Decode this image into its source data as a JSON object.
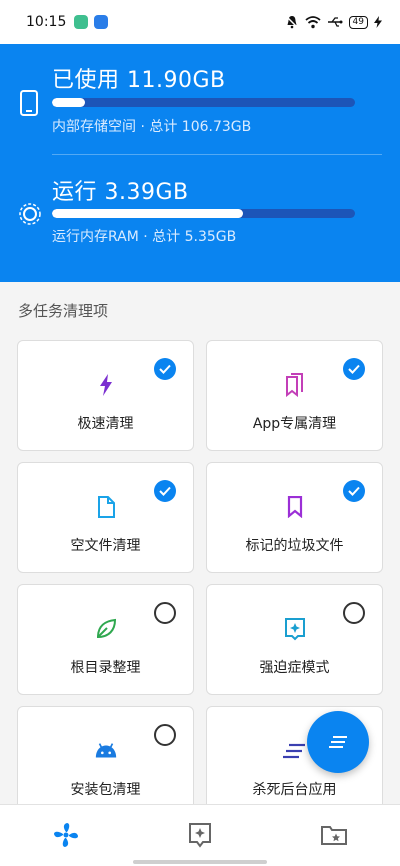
{
  "status_bar": {
    "time": "10:15",
    "battery": "49"
  },
  "storage": {
    "title": "已使用 11.90GB",
    "subtitle": "内部存储空间 · 总计 106.73GB",
    "used_fraction": 0.11
  },
  "ram": {
    "title": "运行 3.39GB",
    "subtitle": "运行内存RAM · 总计 5.35GB",
    "used_fraction": 0.63
  },
  "section_title": "多任务清理项",
  "cards": [
    {
      "label": "极速清理",
      "icon": "bolt-icon",
      "checked": true,
      "color": "#7b2fd0"
    },
    {
      "label": "App专属清理",
      "icon": "bookmarks-icon",
      "checked": true,
      "color": "#c33fb8"
    },
    {
      "label": "空文件清理",
      "icon": "file-icon",
      "checked": true,
      "color": "#1aa3e8"
    },
    {
      "label": "标记的垃圾文件",
      "icon": "bookmark-icon",
      "checked": true,
      "color": "#9b2fd6"
    },
    {
      "label": "根目录整理",
      "icon": "leaf-icon",
      "checked": false,
      "color": "#2fa84f"
    },
    {
      "label": "强迫症模式",
      "icon": "sparkle-box-icon",
      "checked": false,
      "color": "#1a9fd0"
    },
    {
      "label": "安装包清理",
      "icon": "android-icon",
      "checked": false,
      "color": "#1a7be0"
    },
    {
      "label": "杀死后台应用",
      "icon": "lines-icon",
      "checked": false,
      "color": "#3a3fb0"
    }
  ],
  "colors": {
    "accent": "#0a84f0"
  },
  "bottom_nav": [
    "fan-icon",
    "sparkle-box-icon",
    "star-folder-icon"
  ]
}
